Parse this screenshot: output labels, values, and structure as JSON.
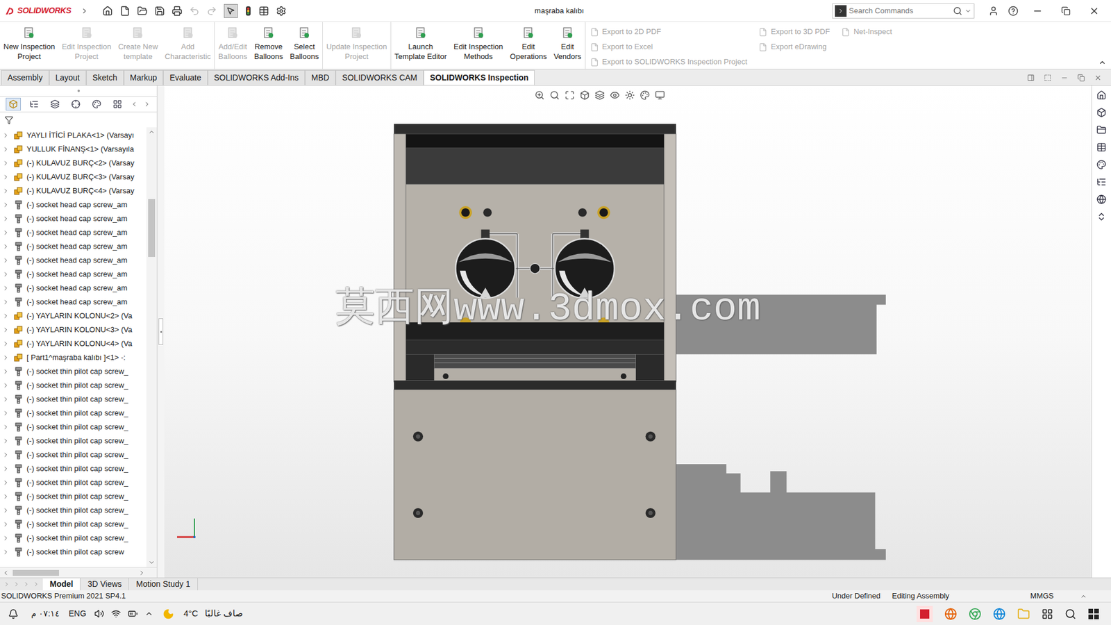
{
  "app": {
    "logo": "SOLIDWORKS",
    "title": "maşraba kalıbı",
    "search_placeholder": "Search Commands"
  },
  "ribbon": {
    "groups": [
      [
        {
          "lines": [
            "New Inspection",
            "Project"
          ],
          "disabled": false
        },
        {
          "lines": [
            "Edit Inspection",
            "Project"
          ],
          "disabled": true
        },
        {
          "lines": [
            "Create New",
            "template"
          ],
          "disabled": true
        },
        {
          "lines": [
            "Add",
            "Characteristic"
          ],
          "disabled": true
        }
      ],
      [
        {
          "lines": [
            "Add/Edit",
            "Balloons"
          ],
          "disabled": true
        },
        {
          "lines": [
            "Remove",
            "Balloons"
          ],
          "disabled": false
        },
        {
          "lines": [
            "Select",
            "Balloons"
          ],
          "disabled": false
        }
      ],
      [
        {
          "lines": [
            "Update Inspection",
            "Project"
          ],
          "disabled": true
        }
      ],
      [
        {
          "lines": [
            "Launch",
            "Template Editor"
          ],
          "disabled": false
        },
        {
          "lines": [
            "Edit Inspection",
            "Methods"
          ],
          "disabled": false
        },
        {
          "lines": [
            "Edit",
            "Operations"
          ],
          "disabled": false
        },
        {
          "lines": [
            "Edit",
            "Vendors"
          ],
          "disabled": false
        }
      ]
    ],
    "export_columns": [
      [
        {
          "label": "Export to 2D PDF",
          "disabled": true
        },
        {
          "label": "Export to Excel",
          "disabled": true
        },
        {
          "label": "Export to SOLIDWORKS Inspection Project",
          "disabled": true
        }
      ],
      [
        {
          "label": "Export to 3D PDF",
          "disabled": true
        },
        {
          "label": "Export eDrawing",
          "disabled": true
        }
      ],
      [
        {
          "label": "Net-Inspect",
          "disabled": true
        }
      ]
    ]
  },
  "tabs": [
    {
      "label": "Assembly",
      "selected": false
    },
    {
      "label": "Layout",
      "selected": false
    },
    {
      "label": "Sketch",
      "selected": false
    },
    {
      "label": "Markup",
      "selected": false
    },
    {
      "label": "Evaluate",
      "selected": false
    },
    {
      "label": "SOLIDWORKS Add-Ins",
      "selected": false
    },
    {
      "label": "MBD",
      "selected": false
    },
    {
      "label": "SOLIDWORKS CAM",
      "selected": false
    },
    {
      "label": "SOLIDWORKS Inspection",
      "selected": true
    }
  ],
  "tree": [
    {
      "label": "YAYLI İTİCİ PLAKA<1> (Varsayı",
      "kind": "assembly"
    },
    {
      "label": "YULLUK FİNANŞ<1> (Varsayıla",
      "kind": "assembly"
    },
    {
      "label": "(-) KULAVUZ BURÇ<2> (Varsay",
      "kind": "assembly"
    },
    {
      "label": "(-) KULAVUZ BURÇ<3> (Varsay",
      "kind": "assembly"
    },
    {
      "label": "(-) KULAVUZ BURÇ<4> (Varsay",
      "kind": "assembly"
    },
    {
      "label": "(-) socket head cap screw_am",
      "kind": "screw"
    },
    {
      "label": "(-) socket head cap screw_am",
      "kind": "screw"
    },
    {
      "label": "(-) socket head cap screw_am",
      "kind": "screw"
    },
    {
      "label": "(-) socket head cap screw_am",
      "kind": "screw"
    },
    {
      "label": "(-) socket head cap screw_am",
      "kind": "screw"
    },
    {
      "label": "(-) socket head cap screw_am",
      "kind": "screw"
    },
    {
      "label": "(-) socket head cap screw_am",
      "kind": "screw"
    },
    {
      "label": "(-) socket head cap screw_am",
      "kind": "screw"
    },
    {
      "label": "(-) YAYLARIN  KOLONU<2> (Va",
      "kind": "assembly"
    },
    {
      "label": "(-) YAYLARIN  KOLONU<3> (Va",
      "kind": "assembly"
    },
    {
      "label": "(-) YAYLARIN  KOLONU<4> (Va",
      "kind": "assembly"
    },
    {
      "label": "[ Part1^maşraba kalıbı ]<1> -:",
      "kind": "assembly"
    },
    {
      "label": "(-) socket thin pilot cap screw_",
      "kind": "screw"
    },
    {
      "label": "(-) socket thin pilot cap screw_",
      "kind": "screw"
    },
    {
      "label": "(-) socket thin pilot cap screw_",
      "kind": "screw"
    },
    {
      "label": "(-) socket thin pilot cap screw_",
      "kind": "screw"
    },
    {
      "label": "(-) socket thin pilot cap screw_",
      "kind": "screw"
    },
    {
      "label": "(-) socket thin pilot cap screw_",
      "kind": "screw"
    },
    {
      "label": "(-) socket thin pilot cap screw_",
      "kind": "screw"
    },
    {
      "label": "(-) socket thin pilot cap screw_",
      "kind": "screw"
    },
    {
      "label": "(-) socket thin pilot cap screw_",
      "kind": "screw"
    },
    {
      "label": "(-) socket thin pilot cap screw_",
      "kind": "screw"
    },
    {
      "label": "(-) socket thin pilot cap screw_",
      "kind": "screw"
    },
    {
      "label": "(-) socket thin pilot cap screw_",
      "kind": "screw"
    },
    {
      "label": "(-) socket thin pilot cap screw_",
      "kind": "screw"
    },
    {
      "label": "(-) socket thin pilot cap screw",
      "kind": "screw"
    }
  ],
  "viewport": {
    "watermark": "莫西网www.3dmox.com"
  },
  "bottom_tabs": [
    {
      "label": "Model",
      "selected": true
    },
    {
      "label": "3D Views",
      "selected": false
    },
    {
      "label": "Motion Study 1",
      "selected": false
    }
  ],
  "status_bar": {
    "left": "SOLIDWORKS Premium 2021 SP4.1",
    "items": [
      "Under Defined",
      "Editing Assembly",
      "MMGS"
    ]
  },
  "taskbar": {
    "time": "٠٧:١٤ م",
    "language": "ENG",
    "temperature": "4°C",
    "weather": "صاف غالبًا"
  }
}
